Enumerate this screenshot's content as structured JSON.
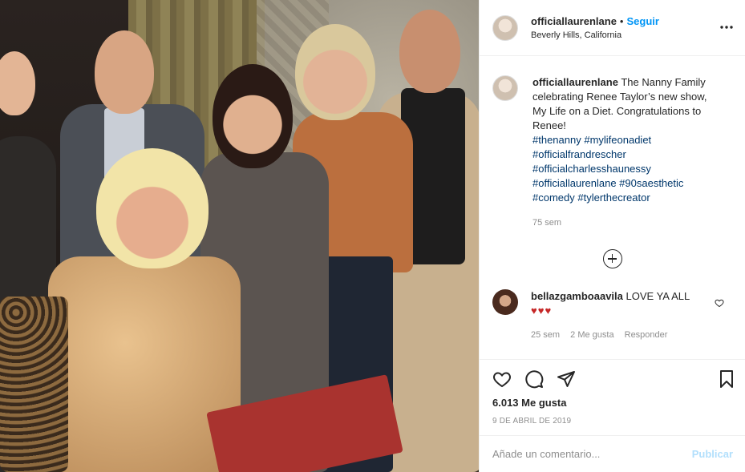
{
  "header": {
    "username": "officiallaurenlane",
    "separator": "•",
    "follow_label": "Seguir",
    "location": "Beverly Hills, California",
    "more_icon": "more-horizontal-icon"
  },
  "caption": {
    "username": "officiallaurenlane",
    "text": "The Nanny Family celebrating Renee Taylor’s new show, My Life on a Diet. Congratulations to Renee!",
    "tags": [
      "#thenanny #mylifeonadiet",
      "#officialfrandrescher",
      "#officialcharlesshaunessy",
      "#officiallaurenlane #90saesthetic",
      "#comedy #tylerthecreator"
    ],
    "time": "75 sem"
  },
  "load_more_icon": "plus-circle-icon",
  "comment": {
    "username": "bellazgamboaavila",
    "text": "LOVE YA ALL",
    "hearts": "♥♥♥",
    "time": "25 sem",
    "likes": "2 Me gusta",
    "reply_label": "Responder"
  },
  "actions": {
    "likes_count": "6.013 Me gusta",
    "date": "9 DE ABRIL DE 2019"
  },
  "add_comment": {
    "placeholder": "Añade un comentario...",
    "publish_label": "Publicar"
  },
  "colors": {
    "accent": "#0095f6",
    "link": "#00376b",
    "muted": "#8e8e8e",
    "publish_disabled": "#b2dffc"
  }
}
